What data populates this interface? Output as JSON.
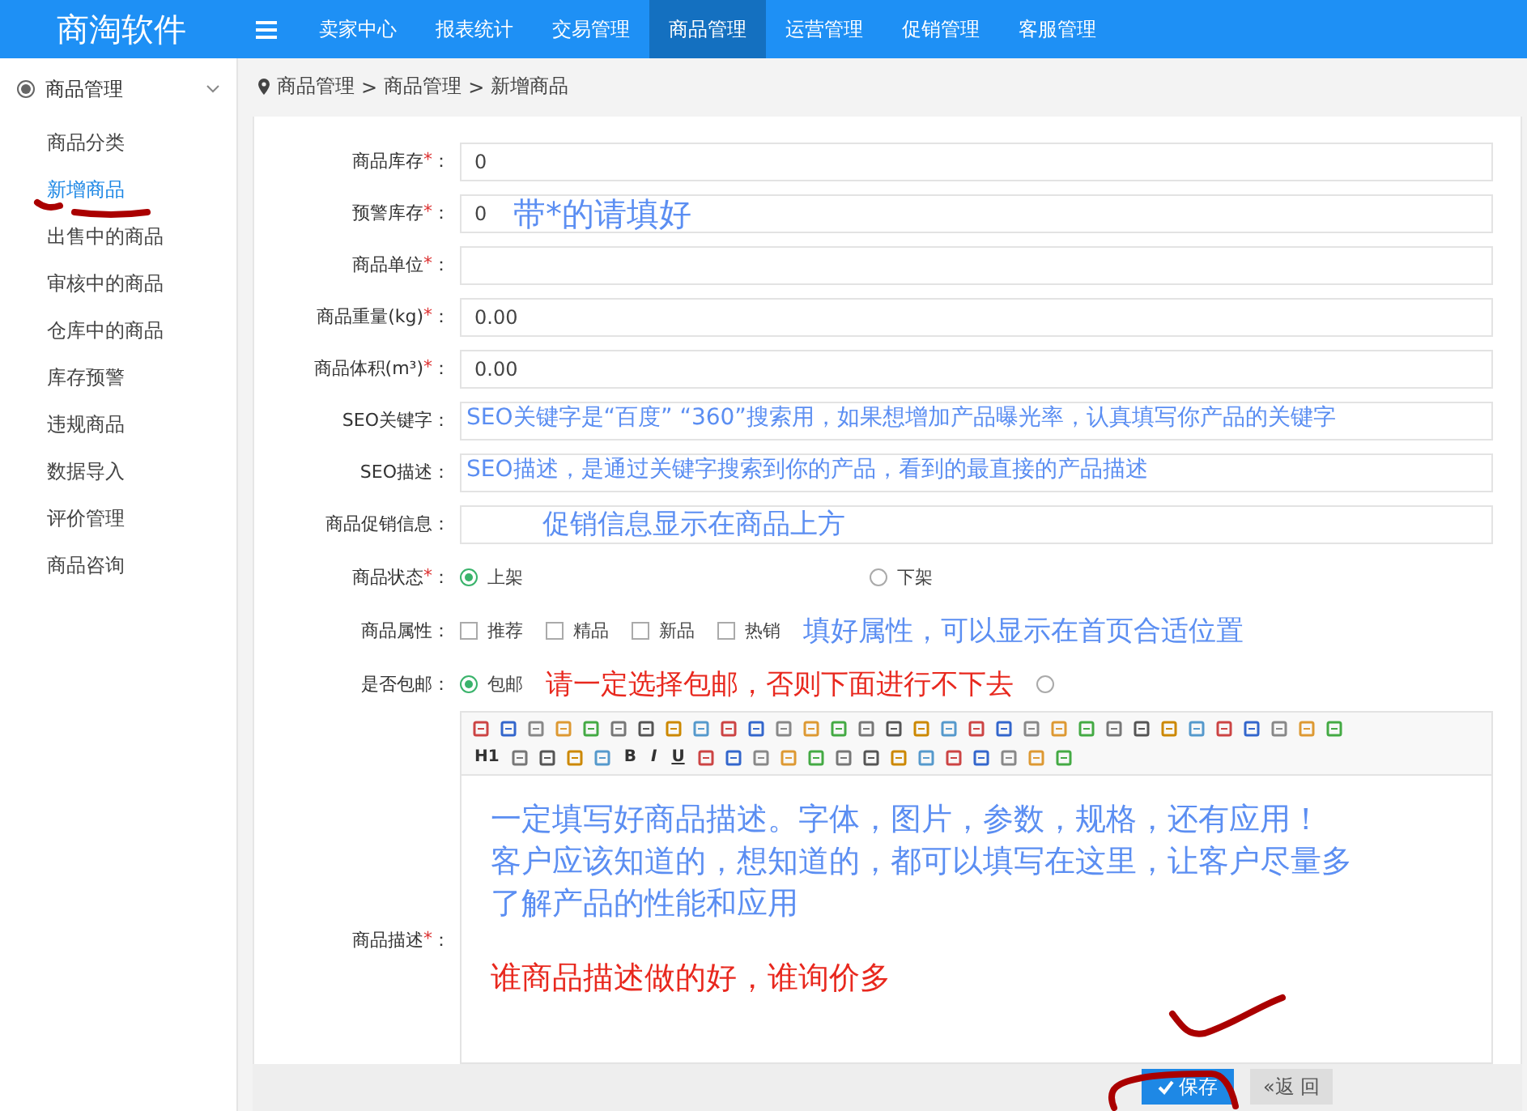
{
  "app": {
    "logo": "商淘软件"
  },
  "nav": [
    {
      "label": "卖家中心",
      "selected": false
    },
    {
      "label": "报表统计",
      "selected": false
    },
    {
      "label": "交易管理",
      "selected": false
    },
    {
      "label": "商品管理",
      "selected": true
    },
    {
      "label": "运营管理",
      "selected": false
    },
    {
      "label": "促销管理",
      "selected": false
    },
    {
      "label": "客服管理",
      "selected": false
    }
  ],
  "sidebar": {
    "title": "商品管理",
    "expanded": true,
    "items": [
      {
        "label": "商品分类",
        "selected": false
      },
      {
        "label": "新增商品",
        "selected": true
      },
      {
        "label": "出售中的商品",
        "selected": false
      },
      {
        "label": "审核中的商品",
        "selected": false
      },
      {
        "label": "仓库中的商品",
        "selected": false
      },
      {
        "label": "库存预警",
        "selected": false
      },
      {
        "label": "违规商品",
        "selected": false
      },
      {
        "label": "数据导入",
        "selected": false
      },
      {
        "label": "评价管理",
        "selected": false
      },
      {
        "label": "商品咨询",
        "selected": false
      }
    ]
  },
  "breadcrumb": {
    "separator": ">",
    "items": [
      "商品管理",
      "商品管理",
      "新增商品"
    ]
  },
  "form": {
    "rows": [
      {
        "kind": "input",
        "label": "商品库存",
        "required_mark": "*",
        "colon": "：",
        "value": "0"
      },
      {
        "kind": "input",
        "label": "预警库存",
        "required_mark": "*",
        "colon": "：",
        "value": "0",
        "note": {
          "kind": "heading",
          "text": "带*的请填好",
          "color": "#5b8ef2"
        }
      },
      {
        "kind": "input",
        "label": "商品单位",
        "required_mark": "*",
        "colon": "："
      },
      {
        "kind": "input",
        "label": "商品重量(kg)",
        "required_mark": "*",
        "colon": "：",
        "value": "0.00"
      },
      {
        "kind": "input",
        "label": "商品体积(m³)",
        "required_mark": "*",
        "colon": "：",
        "value": "0.00"
      },
      {
        "kind": "input",
        "label": "SEO关键字",
        "colon": "：",
        "note": {
          "kind": "inline",
          "text": "SEO关键字是“百度” “360”搜索用，如果想增加产品曝光率，认真填写你产品的关键字",
          "color": "#5b8ef2"
        }
      },
      {
        "kind": "input",
        "label": "SEO描述",
        "colon": "：",
        "note": {
          "kind": "inline",
          "text": "SEO描述，是通过关键字搜索到你的产品，看到的最直接的产品描述",
          "color": "#5b8ef2"
        }
      },
      {
        "kind": "input",
        "label": "商品促销信息",
        "colon": "：",
        "note": {
          "kind": "callout",
          "text": "促销信息显示在商品上方",
          "color": "#5b8ef2"
        }
      },
      {
        "kind": "radio",
        "label": "商品状态",
        "required_mark": "*",
        "colon": "：",
        "options": [
          {
            "label": "上架",
            "selected": true
          },
          {
            "label": "下架",
            "selected": false
          }
        ]
      },
      {
        "kind": "checkbox",
        "label": "商品属性",
        "colon": "：",
        "options": [
          {
            "label": "推荐",
            "checked": false
          },
          {
            "label": "精品",
            "checked": false
          },
          {
            "label": "新品",
            "checked": false
          },
          {
            "label": "热销",
            "checked": false
          }
        ],
        "note": {
          "kind": "callout",
          "text": "填好属性，可以显示在首页合适位置",
          "color": "#5b8ef2"
        }
      },
      {
        "kind": "radio",
        "label": "是否包邮",
        "colon": "：",
        "options": [
          {
            "label": "包邮",
            "selected": true
          },
          {
            "selected": false
          }
        ],
        "note": {
          "kind": "callout",
          "text": "请一定选择包邮，否则下面进行不下去",
          "color": "#e8281e"
        }
      },
      {
        "kind": "editor",
        "label": "商品描述",
        "required_mark": "*",
        "colon": "：",
        "toolbar_text": [
          "H1",
          "B",
          "I",
          "U"
        ],
        "content": [
          {
            "text": "一定填写好商品描述。字体，图片，参数，规格，还有应用！",
            "color": "#5b8ef2"
          },
          {
            "text": "客户应该知道的，想知道的，都可以填写在这里，让客户尽量多了解产品的性能和应用",
            "color": "#5b8ef2"
          },
          {
            "text": "谁商品描述做的好，谁询价多",
            "color": "#e8281e"
          }
        ]
      }
    ]
  },
  "footer": {
    "save": "保存",
    "back": "«返 回"
  }
}
